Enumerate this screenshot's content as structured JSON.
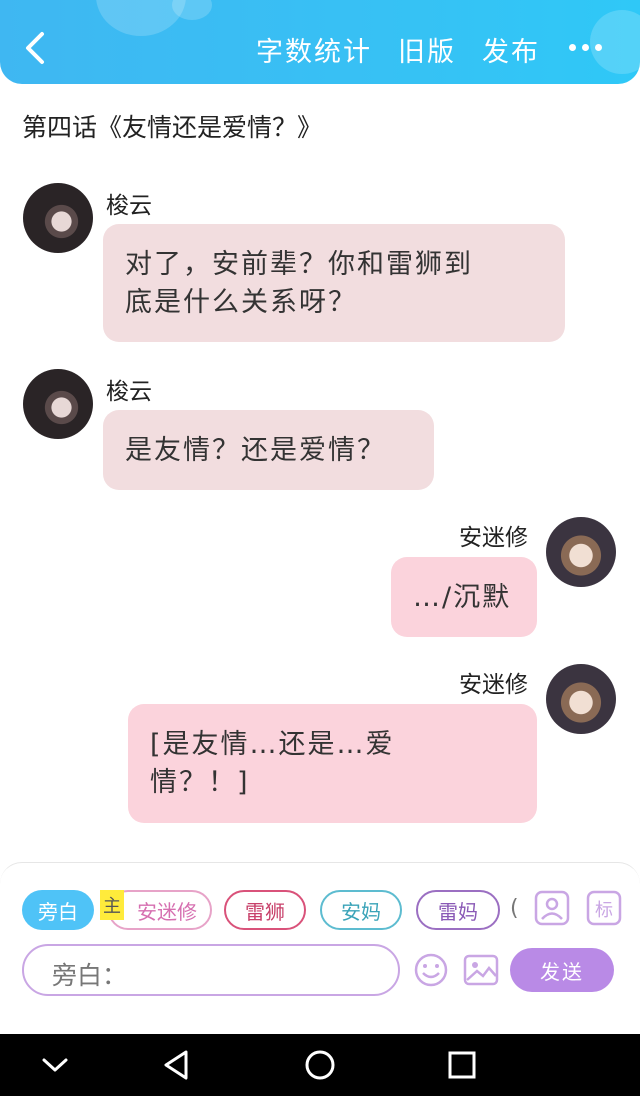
{
  "header": {
    "actions": [
      "字数统计",
      "旧版",
      "发布"
    ]
  },
  "chapter_title": "第四话《友情还是爱情？》",
  "messages": [
    {
      "sender": "梭云",
      "side": "left",
      "text_lines": [
        "对了，安前辈？你和雷狮到",
        "底是什么关系呀？"
      ]
    },
    {
      "sender": "梭云",
      "side": "left",
      "text_lines": [
        "是友情？还是爱情？"
      ]
    },
    {
      "sender": "安迷修",
      "side": "right",
      "text_lines": [
        "…/沉默"
      ]
    },
    {
      "sender": "安迷修",
      "side": "right",
      "text_lines": [
        "[是友情…还是…爱",
        "情？！]"
      ]
    }
  ],
  "role_chips": {
    "narration": "旁白",
    "main_tag": "主",
    "chars": [
      "安迷修",
      "雷狮",
      "安妈",
      "雷妈"
    ],
    "overflow": "("
  },
  "input": {
    "placeholder": "旁白："
  },
  "send_label": "发送",
  "colors": {
    "header": "#37c1f4",
    "left_bubble": "#f2dddf",
    "right_bubble": "#fbd3dc",
    "send": "#b98ae6"
  }
}
